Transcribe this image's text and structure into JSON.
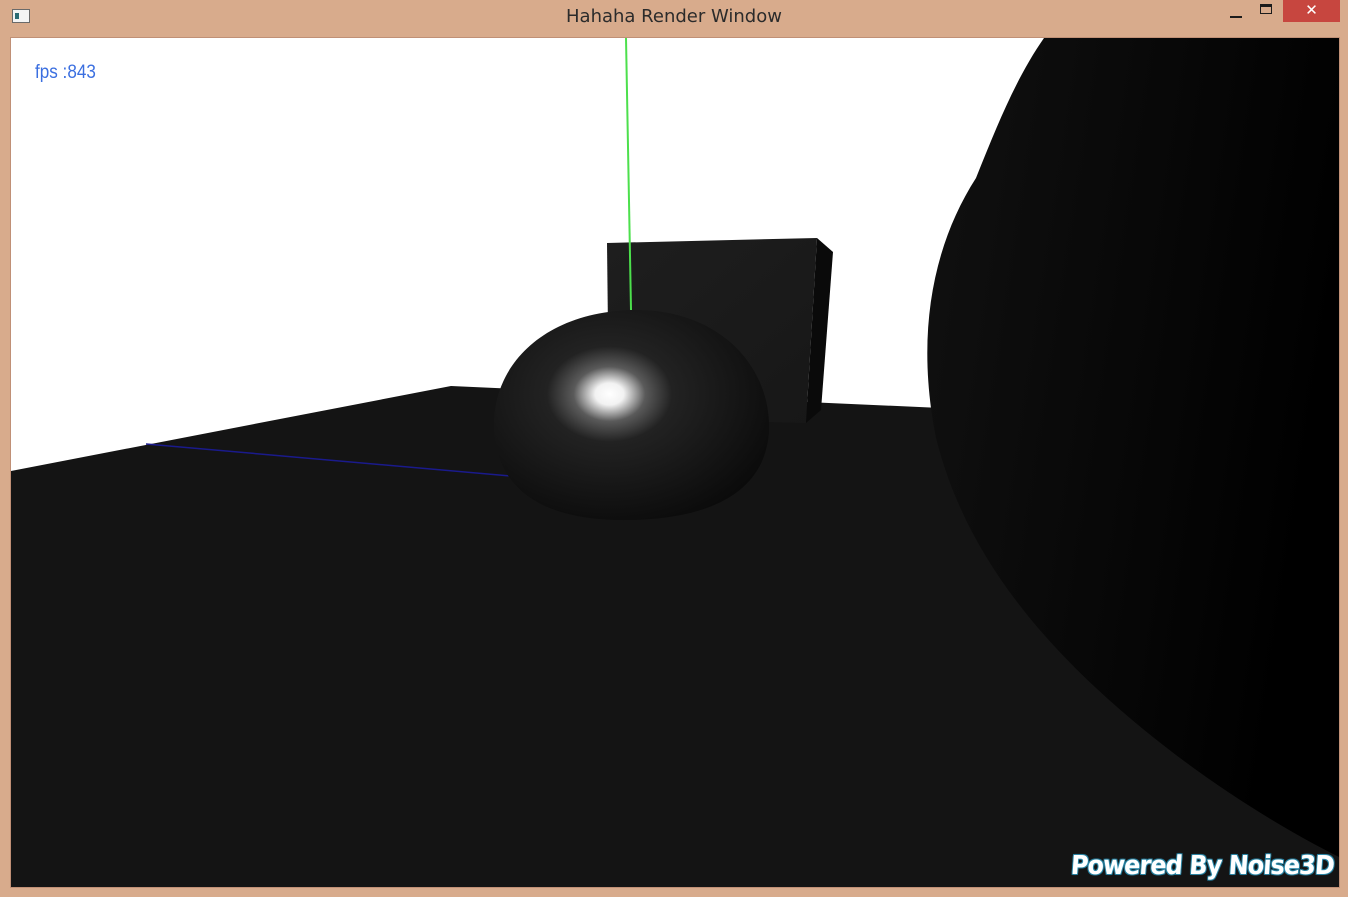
{
  "window": {
    "title": "Hahaha Render Window",
    "app_icon": "window-app-icon",
    "controls": {
      "minimize_icon": "minimize-icon",
      "maximize_icon": "maximize-icon",
      "close_label": "✕"
    }
  },
  "overlay": {
    "fps_text": "fps :843",
    "watermark_text": "Powered By Noise3D"
  },
  "colors": {
    "frame": "#d8ab8c",
    "close_button": "#c7463f",
    "background": "#ffffff",
    "ground": "#141414",
    "fps_text": "#3b6fe0",
    "y_axis": "#4ce04c",
    "x_axis": "#1a1a8c"
  },
  "scene": {
    "objects": [
      "ground-plane",
      "cube",
      "sphere",
      "large-sphere",
      "y-axis-line",
      "x-axis-line"
    ]
  }
}
